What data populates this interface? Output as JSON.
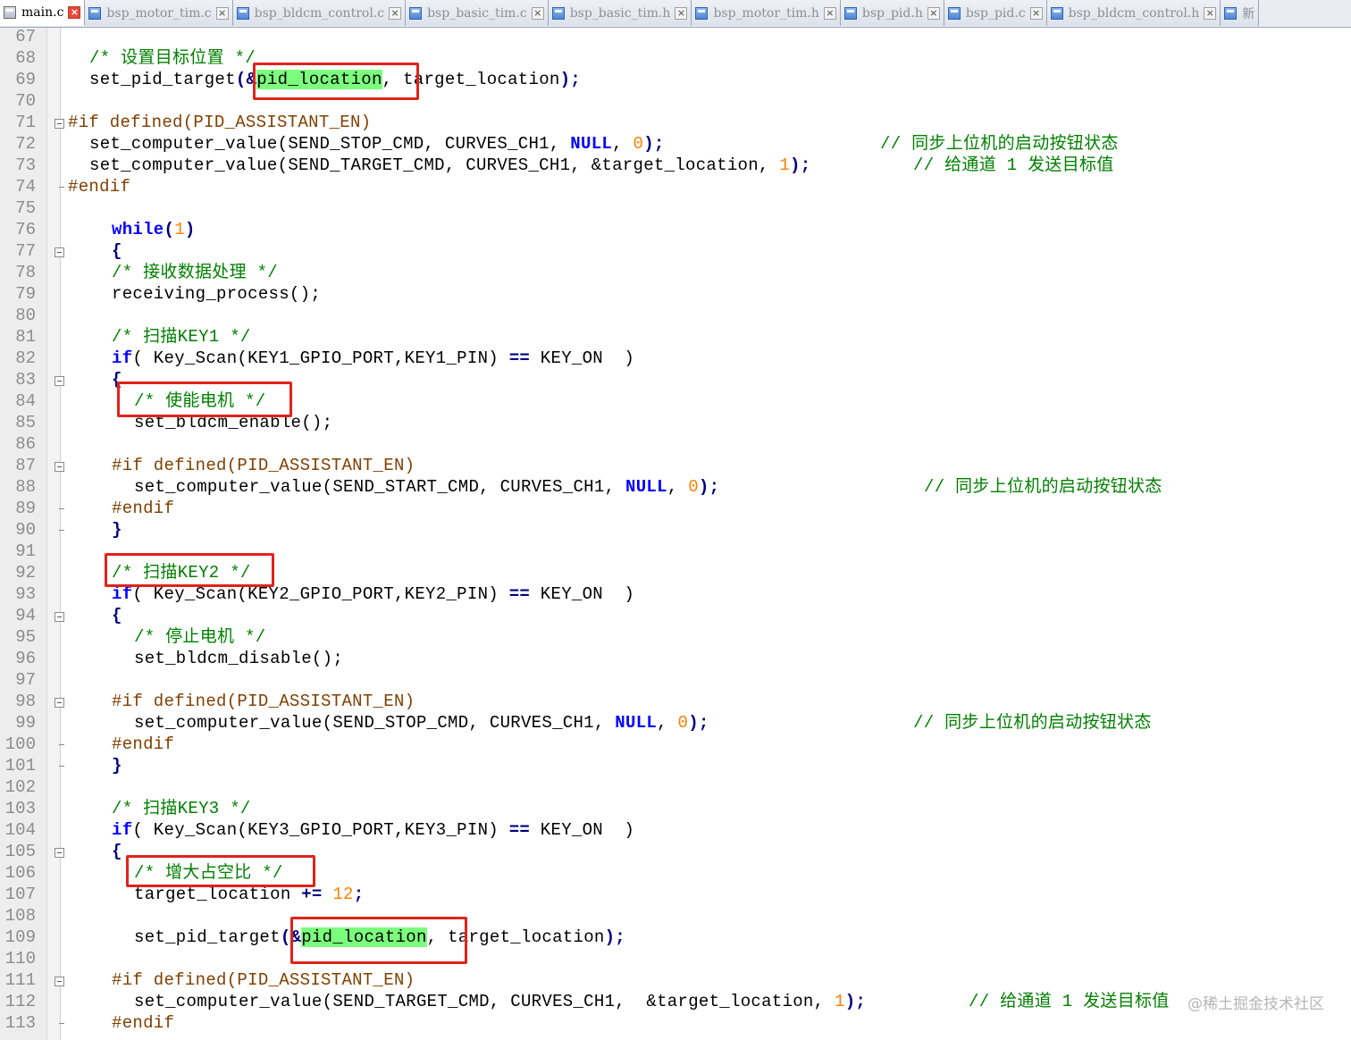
{
  "tabs": [
    {
      "label": "main.c",
      "active": true
    },
    {
      "label": "bsp_motor_tim.c",
      "active": false
    },
    {
      "label": "bsp_bldcm_control.c",
      "active": false
    },
    {
      "label": "bsp_basic_tim.c",
      "active": false
    },
    {
      "label": "bsp_basic_tim.h",
      "active": false
    },
    {
      "label": "bsp_motor_tim.h",
      "active": false
    },
    {
      "label": "bsp_pid.h",
      "active": false
    },
    {
      "label": "bsp_pid.c",
      "active": false
    },
    {
      "label": "bsp_bldcm_control.h",
      "active": false
    },
    {
      "label": "新",
      "active": false
    }
  ],
  "line_numbers": [
    "67",
    "68",
    "69",
    "70",
    "71",
    "72",
    "73",
    "74",
    "75",
    "76",
    "77",
    "78",
    "79",
    "80",
    "81",
    "82",
    "83",
    "84",
    "85",
    "86",
    "87",
    "88",
    "89",
    "90",
    "91",
    "92",
    "93",
    "94",
    "95",
    "96",
    "97",
    "98",
    "99",
    "100",
    "101",
    "102",
    "103",
    "104",
    "105",
    "106",
    "107",
    "108",
    "109",
    "110",
    "111",
    "112",
    "113"
  ],
  "code": {
    "l68_comment": "/* 设置目标位置 */",
    "l69_a": "set_pid_target",
    "l69_b": "(",
    "l69_c": "&",
    "l69_hl": "pid_location",
    "l69_d": ", target_location",
    "l69_e": ");",
    "l71": "#if defined(PID_ASSISTANT_EN)",
    "l72_a": "set_computer_value",
    "l72_b": "(SEND_STOP_CMD, CURVES_CH1, ",
    "l72_null": "NULL",
    "l72_c": ", ",
    "l72_num": "0",
    "l72_d": ");",
    "l72_comment": "// 同步上位机的启动按钮状态",
    "l73_a": "set_computer_value",
    "l73_b": "(SEND_TARGET_CMD, CURVES_CH1, &target_location, ",
    "l73_num": "1",
    "l73_d": ");",
    "l73_comment": "// 给通道 1 发送目标值",
    "l74": "#endif",
    "l76_kw": "while",
    "l76_a": "(",
    "l76_num": "1",
    "l76_b": ")",
    "brace_open": "{",
    "brace_close": "}",
    "l78": "/* 接收数据处理 */",
    "l79": "receiving_process();",
    "l81": "/* 扫描KEY1 */",
    "kw_if": "if",
    "l82_a": "( Key_Scan(KEY1_GPIO_PORT,KEY1_PIN) ",
    "op_eq": "==",
    "l82_b": " KEY_ON  )",
    "l84": "/* 使能电机 */",
    "l85": "set_bldcm_enable();",
    "l87": "#if defined(PID_ASSISTANT_EN)",
    "l88_a": "set_computer_value(SEND_START_CMD, CURVES_CH1, ",
    "l88_null": "NULL",
    "l88_c": ", ",
    "l88_num": "0",
    "l88_d": ");",
    "l88_comment": "// 同步上位机的启动按钮状态",
    "l89": "#endif",
    "l92": "/* 扫描KEY2 */",
    "l93_a": "( Key_Scan(KEY2_GPIO_PORT,KEY2_PIN) ",
    "l93_b": " KEY_ON  )",
    "l95": "/* 停止电机 */",
    "l96": "set_bldcm_disable();",
    "l98": "#if defined(PID_ASSISTANT_EN)",
    "l99_a": "set_computer_value(SEND_STOP_CMD, CURVES_CH1, ",
    "l99_null": "NULL",
    "l99_c": ", ",
    "l99_num": "0",
    "l99_d": ");",
    "l99_comment": "// 同步上位机的启动按钮状态",
    "l100": "#endif",
    "l103": "/* 扫描KEY3 */",
    "l104_a": "( Key_Scan(KEY3_GPIO_PORT,KEY3_PIN) ",
    "l104_b": " KEY_ON  )",
    "l106": "/* 增大占空比 */",
    "l107_a": "target_location ",
    "l107_op": "+=",
    "l107_sp": " ",
    "l107_num": "12",
    "l107_b": ";",
    "l109_a": "set_pid_target",
    "l109_b": "(",
    "l109_c": "&",
    "l109_hl": "pid_location",
    "l109_d": ", target_location",
    "l109_e": ");",
    "l111": "#if defined(PID_ASSISTANT_EN)",
    "l112_a": "set_computer_value(SEND_TARGET_CMD, CURVES_CH1,  &target_location, ",
    "l112_num": "1",
    "l112_d": ");",
    "l112_comment": "// 给通道 1 发送目标值",
    "l113": "#endif"
  },
  "watermark": "@稀土掘金技术社区",
  "colors": {
    "comment": "#008000",
    "preprocessor": "#804000",
    "keyword": "#0000ff",
    "number": "#ff8000",
    "highlight": "#7cff7c",
    "annotation_box": "#e0231b"
  }
}
